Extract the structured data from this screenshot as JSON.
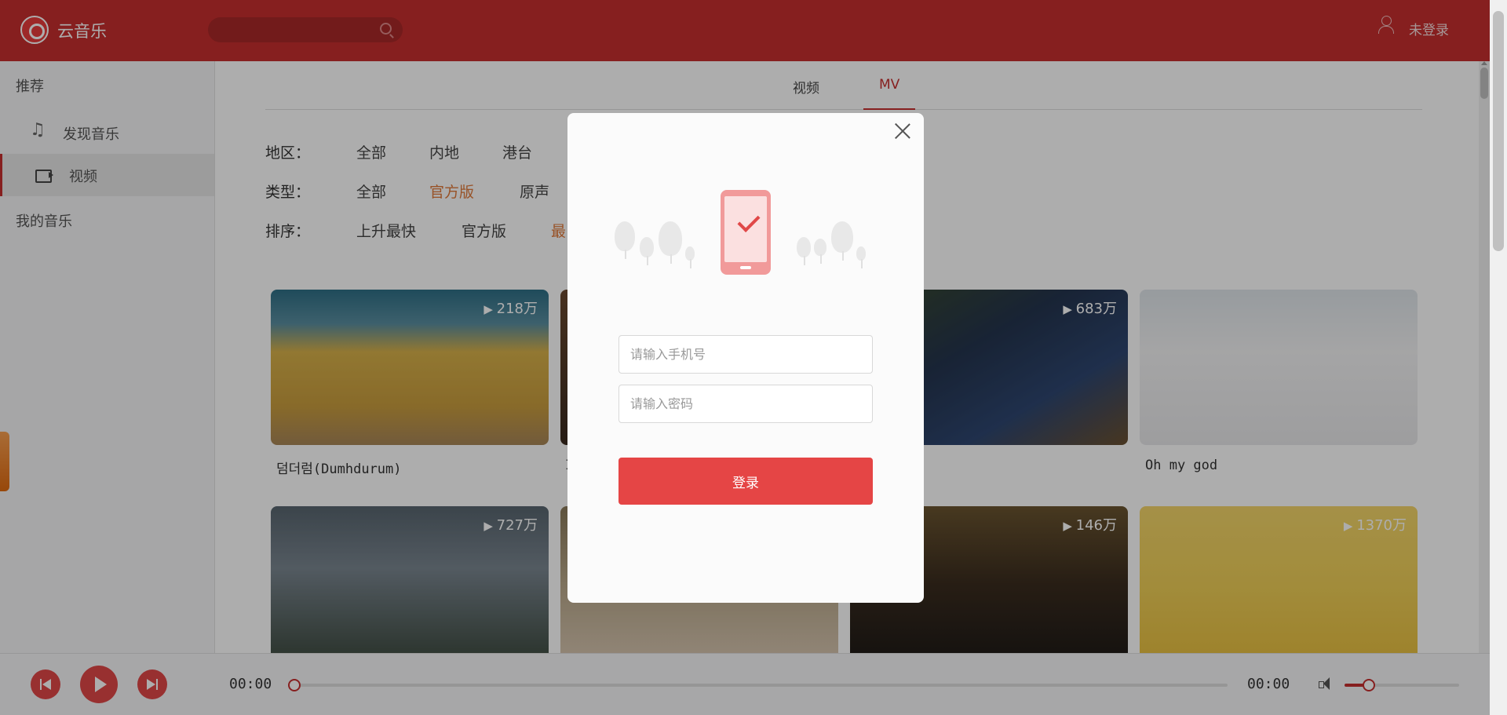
{
  "header": {
    "app_name": "云音乐",
    "search_placeholder": "",
    "login_status": "未登录"
  },
  "sidebar": {
    "heading_recommend": "推荐",
    "items": [
      {
        "label": "发现音乐",
        "icon": "music-note-icon"
      },
      {
        "label": "视频",
        "icon": "video-camera-icon",
        "active": true
      }
    ],
    "heading_my_music": "我的音乐"
  },
  "tabs": [
    {
      "label": "视频"
    },
    {
      "label": "MV",
      "active": true
    }
  ],
  "filters": {
    "region": {
      "label": "地区：",
      "options": [
        "全部",
        "内地",
        "港台"
      ]
    },
    "type": {
      "label": "类型：",
      "options": [
        "全部",
        "官方版",
        "原声"
      ],
      "selected": "官方版"
    },
    "sort": {
      "label": "排序：",
      "options": [
        "上升最快",
        "官方版",
        "最"
      ],
      "selected": "最"
    }
  },
  "mvs": [
    {
      "title": "덤더럼(Dumhdurum)",
      "plays": "218万"
    },
    {
      "title": "I",
      "plays": ""
    },
    {
      "title": "",
      "plays": "683万"
    },
    {
      "title": "Oh my god",
      "plays": ""
    },
    {
      "title": "",
      "plays": "727万"
    },
    {
      "title": "",
      "plays": ""
    },
    {
      "title": "",
      "plays": "146万"
    },
    {
      "title": "",
      "plays": "1370万"
    }
  ],
  "player": {
    "current_time": "00:00",
    "total_time": "00:00",
    "progress": 0,
    "volume": 0.21
  },
  "login_modal": {
    "phone_placeholder": "请输入手机号",
    "password_placeholder": "请输入密码",
    "submit_label": "登录"
  },
  "colors": {
    "brand": "#c62f2f",
    "button": "#e54545",
    "selected_filter": "#e07a3a"
  }
}
